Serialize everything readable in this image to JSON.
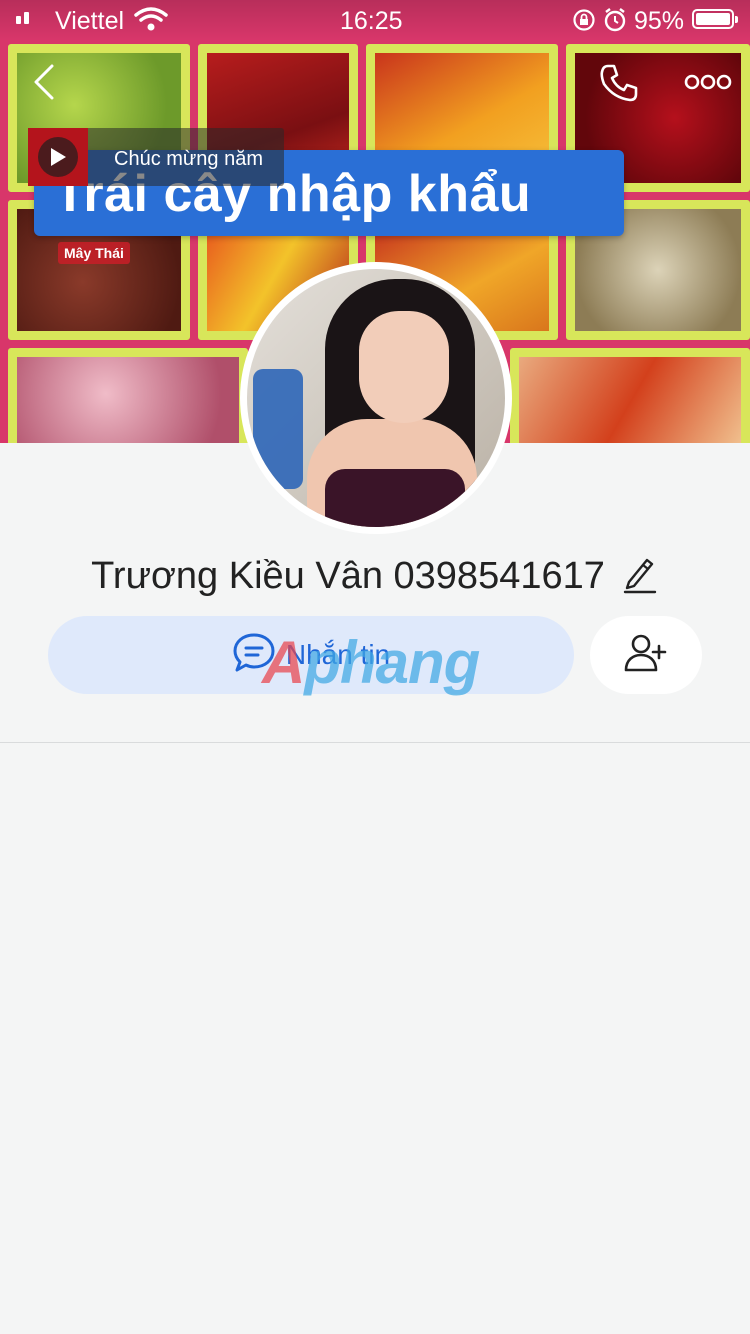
{
  "status_bar": {
    "carrier": "Viettel",
    "time": "16:25",
    "battery": "95%",
    "icons": [
      "signal-icon",
      "wifi-icon",
      "orientation-lock-icon",
      "alarm-icon",
      "battery-icon"
    ]
  },
  "cover": {
    "banner_title": "Trái cây nhập khẩu",
    "mini_label": "Mây Thái",
    "video_caption": "Chúc mừng năm"
  },
  "header": {
    "back_icon": "chevron-left-icon",
    "call_icon": "phone-icon",
    "more_icon": "more-dots-icon"
  },
  "profile": {
    "name": "Trương Kiều Vân 0398541617",
    "edit_icon": "pencil-icon"
  },
  "actions": {
    "message_label": "Nhắn tin",
    "message_icon": "chat-bubble-icon",
    "add_friend_icon": "add-user-icon"
  },
  "watermark": {
    "first": "A",
    "rest": "phang"
  },
  "colors": {
    "accent": "#1f66d7",
    "message_button_bg": "#dfe9fb",
    "page_bg": "#f4f5f5"
  }
}
